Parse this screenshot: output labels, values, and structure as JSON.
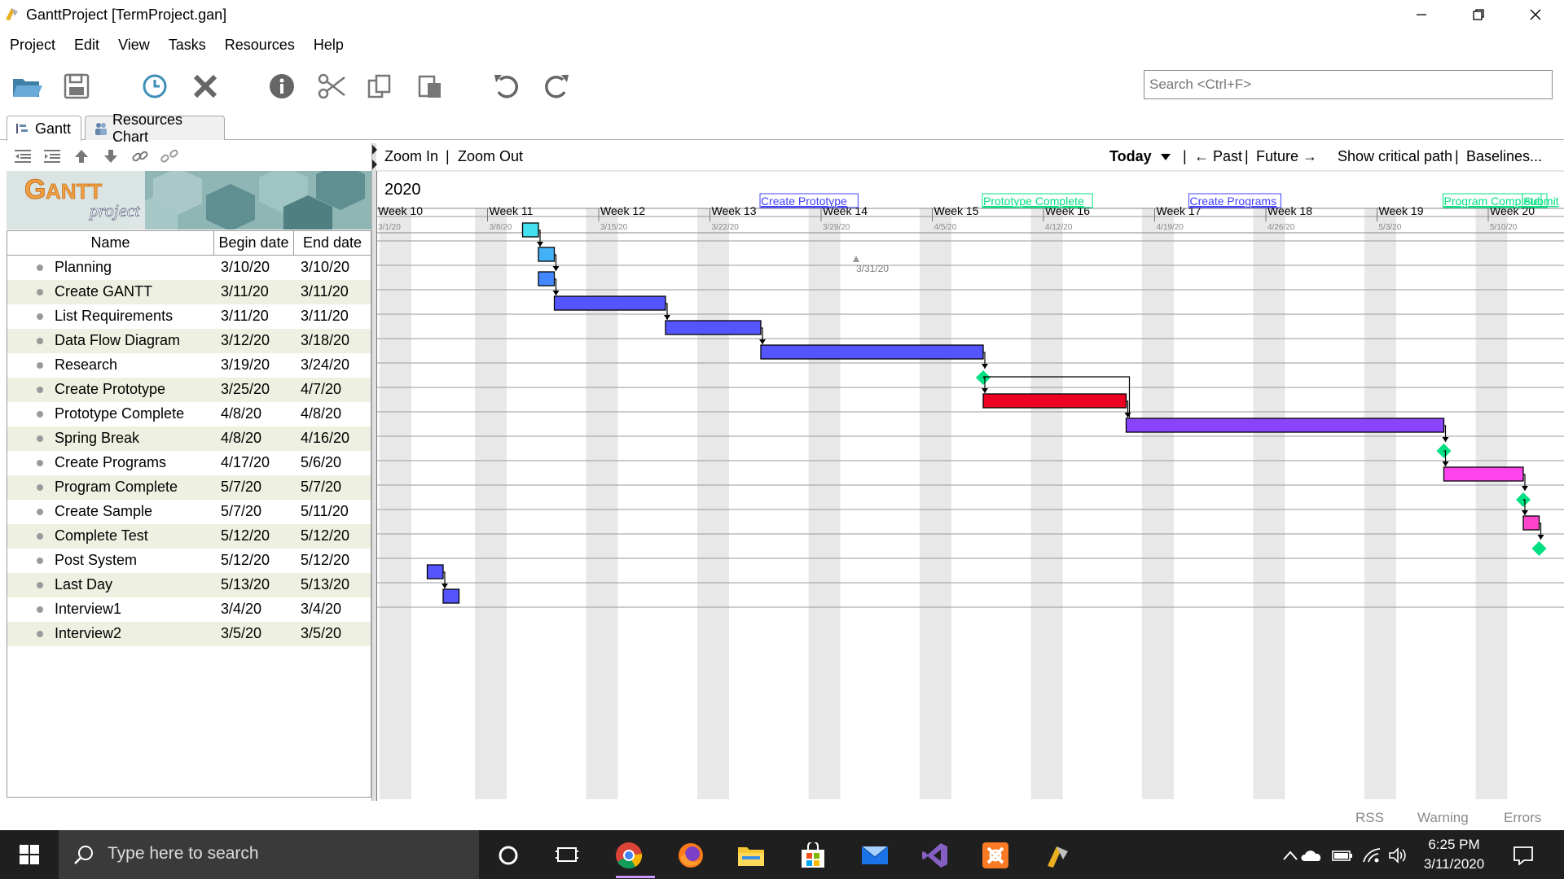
{
  "window": {
    "title": "GanttProject [TermProject.gan]",
    "controls": [
      "minimize-icon",
      "restore-icon",
      "close-icon"
    ]
  },
  "menu": [
    "Project",
    "Edit",
    "View",
    "Tasks",
    "Resources",
    "Help"
  ],
  "toolbar": {
    "icons": [
      "open-folder-icon",
      "save-icon",
      "clock-icon",
      "delete-icon",
      "info-icon",
      "cut-icon",
      "copy-icon",
      "paste-icon",
      "undo-icon",
      "redo-icon"
    ]
  },
  "search": {
    "placeholder": "Search <Ctrl+F>"
  },
  "tabs": [
    {
      "label": "Gantt",
      "icon": "gantt-icon",
      "active": true
    },
    {
      "label": "Resources Chart",
      "icon": "people-icon",
      "active": false
    }
  ],
  "tree_tools": [
    "indent-icon",
    "outdent-icon",
    "move-up-icon",
    "move-down-icon",
    "link-icon",
    "unlink-icon"
  ],
  "logo": {
    "text": "GANTT",
    "subtext": "project"
  },
  "table": {
    "headers": {
      "name": "Name",
      "begin": "Begin date",
      "end": "End date"
    },
    "rows": [
      {
        "name": "Planning",
        "begin": "3/10/20",
        "end": "3/10/20"
      },
      {
        "name": "Create GANTT",
        "begin": "3/11/20",
        "end": "3/11/20"
      },
      {
        "name": "List Requirements",
        "begin": "3/11/20",
        "end": "3/11/20"
      },
      {
        "name": "Data Flow Diagram",
        "begin": "3/12/20",
        "end": "3/18/20"
      },
      {
        "name": "Research",
        "begin": "3/19/20",
        "end": "3/24/20"
      },
      {
        "name": "Create Prototype",
        "begin": "3/25/20",
        "end": "4/7/20"
      },
      {
        "name": "Prototype Complete",
        "begin": "4/8/20",
        "end": "4/8/20"
      },
      {
        "name": "Spring Break",
        "begin": "4/8/20",
        "end": "4/16/20"
      },
      {
        "name": "Create Programs",
        "begin": "4/17/20",
        "end": "5/6/20"
      },
      {
        "name": "Program Complete",
        "begin": "5/7/20",
        "end": "5/7/20"
      },
      {
        "name": "Create Sample",
        "begin": "5/7/20",
        "end": "5/11/20"
      },
      {
        "name": "Complete Test",
        "begin": "5/12/20",
        "end": "5/12/20"
      },
      {
        "name": "Post System",
        "begin": "5/12/20",
        "end": "5/12/20"
      },
      {
        "name": "Last Day",
        "begin": "5/13/20",
        "end": "5/13/20"
      },
      {
        "name": "Interview1",
        "begin": "3/4/20",
        "end": "3/4/20"
      },
      {
        "name": "Interview2",
        "begin": "3/5/20",
        "end": "3/5/20"
      }
    ]
  },
  "chart_toolbar": {
    "zoom_in": "Zoom In",
    "zoom_out": "Zoom Out",
    "today": "Today",
    "past": "← Past",
    "future": "Future →",
    "critical": "Show critical path",
    "baselines": "Baselines...",
    "sep": "|"
  },
  "chart_data": {
    "type": "gantt",
    "year": "2020",
    "weeks": [
      {
        "label": "Week 10",
        "date": "3/1/20"
      },
      {
        "label": "Week 11",
        "date": "3/8/20"
      },
      {
        "label": "Week 12",
        "date": "3/15/20"
      },
      {
        "label": "Week 13",
        "date": "3/22/20"
      },
      {
        "label": "Week 14",
        "date": "3/29/20"
      },
      {
        "label": "Week 15",
        "date": "4/5/20"
      },
      {
        "label": "Week 16",
        "date": "4/12/20"
      },
      {
        "label": "Week 17",
        "date": "4/19/20"
      },
      {
        "label": "Week 18",
        "date": "4/26/20"
      },
      {
        "label": "Week 19",
        "date": "5/3/20"
      },
      {
        "label": "Week 20",
        "date": "5/10/20"
      }
    ],
    "today_marker": "3/31/20",
    "milestone_labels": [
      {
        "text": "Create Prototype",
        "color": "#4040ff"
      },
      {
        "text": "Prototype Complete",
        "color": "#00e080"
      },
      {
        "text": "Create Programs",
        "color": "#4040ff"
      },
      {
        "text": "Program Complete",
        "color": "#00e080"
      },
      {
        "text": "Submit",
        "color": "#00e080"
      }
    ],
    "tasks": [
      {
        "name": "Planning",
        "start": "2020-03-10",
        "end": "2020-03-10",
        "color": "#44e0f0"
      },
      {
        "name": "Create GANTT",
        "start": "2020-03-11",
        "end": "2020-03-11",
        "color": "#44b0f8"
      },
      {
        "name": "List Requirements",
        "start": "2020-03-11",
        "end": "2020-03-11",
        "color": "#4488ff"
      },
      {
        "name": "Data Flow Diagram",
        "start": "2020-03-12",
        "end": "2020-03-18",
        "color": "#5555ff"
      },
      {
        "name": "Research",
        "start": "2020-03-19",
        "end": "2020-03-24",
        "color": "#5555ff"
      },
      {
        "name": "Create Prototype",
        "start": "2020-03-25",
        "end": "2020-04-07",
        "color": "#5555ff"
      },
      {
        "name": "Prototype Complete",
        "start": "2020-04-08",
        "end": "2020-04-08",
        "color": "#00e080",
        "milestone": true
      },
      {
        "name": "Spring Break",
        "start": "2020-04-08",
        "end": "2020-04-16",
        "color": "#ee0022"
      },
      {
        "name": "Create Programs",
        "start": "2020-04-17",
        "end": "2020-05-06",
        "color": "#8844ff"
      },
      {
        "name": "Program Complete",
        "start": "2020-05-07",
        "end": "2020-05-07",
        "color": "#00e080",
        "milestone": true
      },
      {
        "name": "Create Sample",
        "start": "2020-05-07",
        "end": "2020-05-11",
        "color": "#ff44ee"
      },
      {
        "name": "Complete Test",
        "start": "2020-05-12",
        "end": "2020-05-12",
        "color": "#00e080",
        "milestone": true
      },
      {
        "name": "Post System",
        "start": "2020-05-12",
        "end": "2020-05-12",
        "color": "#ff44cc"
      },
      {
        "name": "Last Day",
        "start": "2020-05-13",
        "end": "2020-05-13",
        "color": "#00e080",
        "milestone": true
      },
      {
        "name": "Interview1",
        "start": "2020-03-04",
        "end": "2020-03-04",
        "color": "#5555ff"
      },
      {
        "name": "Interview2",
        "start": "2020-03-05",
        "end": "2020-03-05",
        "color": "#5555ff"
      }
    ]
  },
  "status": {
    "rss": "RSS",
    "warning": "Warning",
    "errors": "Errors"
  },
  "taskbar": {
    "search_placeholder": "Type here to search",
    "apps": [
      "cortana-icon",
      "task-view-icon",
      "chrome-icon",
      "firefox-icon",
      "file-explorer-icon",
      "store-icon",
      "mail-icon",
      "visual-studio-icon",
      "xampp-icon",
      "ganttproject-icon"
    ],
    "time": "6:25 PM",
    "date": "3/11/2020"
  }
}
